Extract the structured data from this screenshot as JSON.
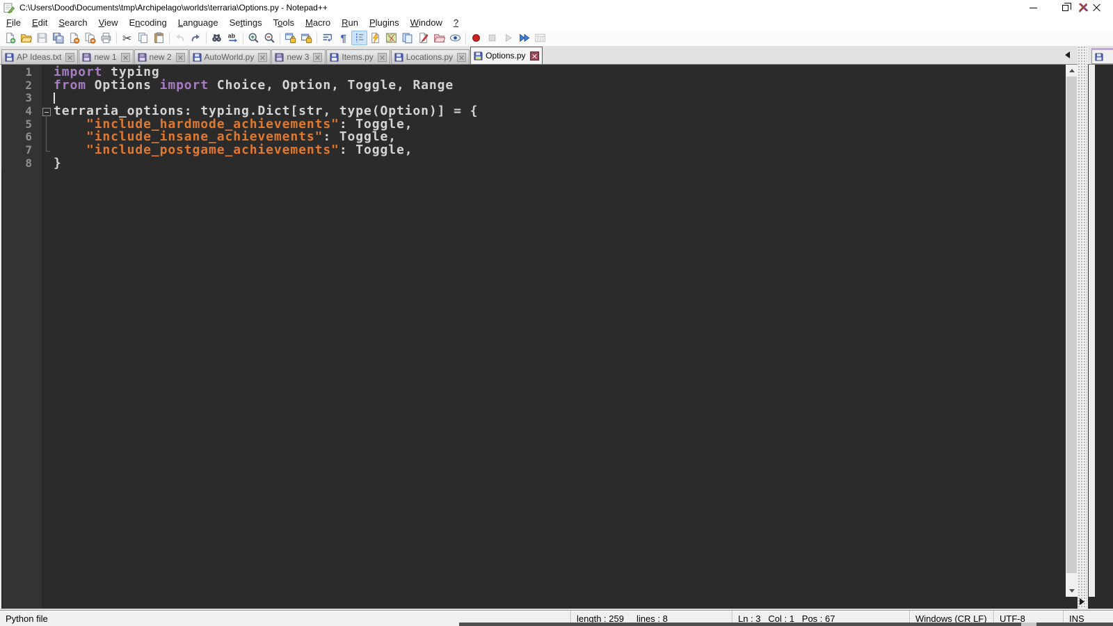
{
  "window": {
    "title": "C:\\Users\\Dood\\Documents\\tmp\\Archipelago\\worlds\\terraria\\Options.py - Notepad++"
  },
  "menu": {
    "items": [
      {
        "label": "File",
        "u": 0
      },
      {
        "label": "Edit",
        "u": 0
      },
      {
        "label": "Search",
        "u": 0
      },
      {
        "label": "View",
        "u": 0
      },
      {
        "label": "Encoding",
        "u": 1
      },
      {
        "label": "Language",
        "u": 0
      },
      {
        "label": "Settings",
        "u": 2
      },
      {
        "label": "Tools",
        "u": 1
      },
      {
        "label": "Macro",
        "u": 0
      },
      {
        "label": "Run",
        "u": 0
      },
      {
        "label": "Plugins",
        "u": 0
      },
      {
        "label": "Window",
        "u": 0
      },
      {
        "label": "?",
        "u": 0
      }
    ]
  },
  "toolbar": {
    "items": [
      {
        "name": "new-file"
      },
      {
        "name": "open-file"
      },
      {
        "name": "save-file",
        "state": "disabled"
      },
      {
        "name": "save-all"
      },
      {
        "name": "close-file"
      },
      {
        "name": "close-all"
      },
      {
        "name": "print"
      },
      {
        "sep": true
      },
      {
        "name": "cut"
      },
      {
        "name": "copy"
      },
      {
        "name": "paste"
      },
      {
        "sep": true
      },
      {
        "name": "undo",
        "state": "disabled"
      },
      {
        "name": "redo"
      },
      {
        "sep": true
      },
      {
        "name": "find"
      },
      {
        "name": "replace"
      },
      {
        "sep": true
      },
      {
        "name": "zoom-in"
      },
      {
        "name": "zoom-out"
      },
      {
        "sep": true
      },
      {
        "name": "sync-vertical-scroll"
      },
      {
        "name": "sync-horizontal-scroll"
      },
      {
        "sep": true
      },
      {
        "name": "word-wrap"
      },
      {
        "name": "show-all-characters"
      },
      {
        "name": "indent-guide",
        "state": "active"
      },
      {
        "name": "function-list"
      },
      {
        "name": "document-map"
      },
      {
        "name": "document-switcher"
      },
      {
        "name": "function-signature"
      },
      {
        "name": "folder-as-workspace"
      },
      {
        "name": "file-monitoring"
      },
      {
        "sep": true
      },
      {
        "name": "macro-record"
      },
      {
        "name": "macro-stop",
        "state": "disabled"
      },
      {
        "name": "macro-play",
        "state": "disabled"
      },
      {
        "name": "macro-run-multiple"
      },
      {
        "name": "macro-save",
        "state": "disabled"
      }
    ]
  },
  "tabs": {
    "items": [
      {
        "label": "AP Ideas.txt",
        "icon": "saved-file-icon",
        "active": false
      },
      {
        "label": "new 1",
        "icon": "unsaved-file-icon",
        "active": false
      },
      {
        "label": "new 2",
        "icon": "unsaved-file-icon",
        "active": false
      },
      {
        "label": "AutoWorld.py",
        "icon": "saved-file-icon",
        "active": false
      },
      {
        "label": "new 3",
        "icon": "unsaved-file-icon",
        "active": false
      },
      {
        "label": "Items.py",
        "icon": "saved-file-icon",
        "active": false
      },
      {
        "label": "Locations.py",
        "icon": "saved-file-icon",
        "active": false
      },
      {
        "label": "Options.py",
        "icon": "active-file-icon",
        "active": true
      }
    ]
  },
  "editor": {
    "caret": {
      "line": 3,
      "col": 1
    },
    "lines": [
      {
        "num": "1",
        "fold": "",
        "tokens": [
          [
            "kw",
            "import"
          ],
          [
            "def",
            " typing"
          ]
        ]
      },
      {
        "num": "2",
        "fold": "",
        "tokens": [
          [
            "kw",
            "from"
          ],
          [
            "def",
            " Options "
          ],
          [
            "kw",
            "import"
          ],
          [
            "def",
            " Choice, Option, Toggle, Range"
          ]
        ]
      },
      {
        "num": "3",
        "fold": "",
        "caret": true,
        "tokens": []
      },
      {
        "num": "4",
        "fold": "box",
        "tokens": [
          [
            "def",
            "terraria_options: typing.Dict[str, type(Option)] = {"
          ]
        ]
      },
      {
        "num": "5",
        "fold": "line",
        "tokens": [
          [
            "def",
            "    "
          ],
          [
            "str",
            "\"include_hardmode_achievements\""
          ],
          [
            "def",
            ": Toggle,"
          ]
        ]
      },
      {
        "num": "6",
        "fold": "line",
        "tokens": [
          [
            "def",
            "    "
          ],
          [
            "str",
            "\"include_insane_achievements\""
          ],
          [
            "def",
            ": Toggle,"
          ]
        ]
      },
      {
        "num": "7",
        "fold": "corner",
        "tokens": [
          [
            "def",
            "    "
          ],
          [
            "str",
            "\"include_postgame_achievements\""
          ],
          [
            "def",
            ": Toggle,"
          ]
        ]
      },
      {
        "num": "8",
        "fold": "",
        "tokens": [
          [
            "def",
            "}"
          ]
        ]
      }
    ]
  },
  "status": {
    "segments": [
      {
        "name": "doc-type",
        "text": "Python file"
      },
      {
        "name": "doc-size",
        "text": "length : 259     lines : 8"
      },
      {
        "name": "cursor-position",
        "text": "Ln : 3   Col : 1   Pos : 67"
      },
      {
        "name": "eol-format",
        "text": "Windows (CR LF)"
      },
      {
        "name": "encoding",
        "text": "UTF-8"
      },
      {
        "name": "insert-mode",
        "text": "INS"
      }
    ]
  },
  "colors": {
    "editor_bg": "#2b2b2b",
    "margin_bg": "#333333",
    "keyword": "#a87bc5",
    "string": "#e0792f",
    "default_text": "#d4d4d4",
    "line_number": "#909090",
    "active_tab_close": "#9e4653"
  }
}
